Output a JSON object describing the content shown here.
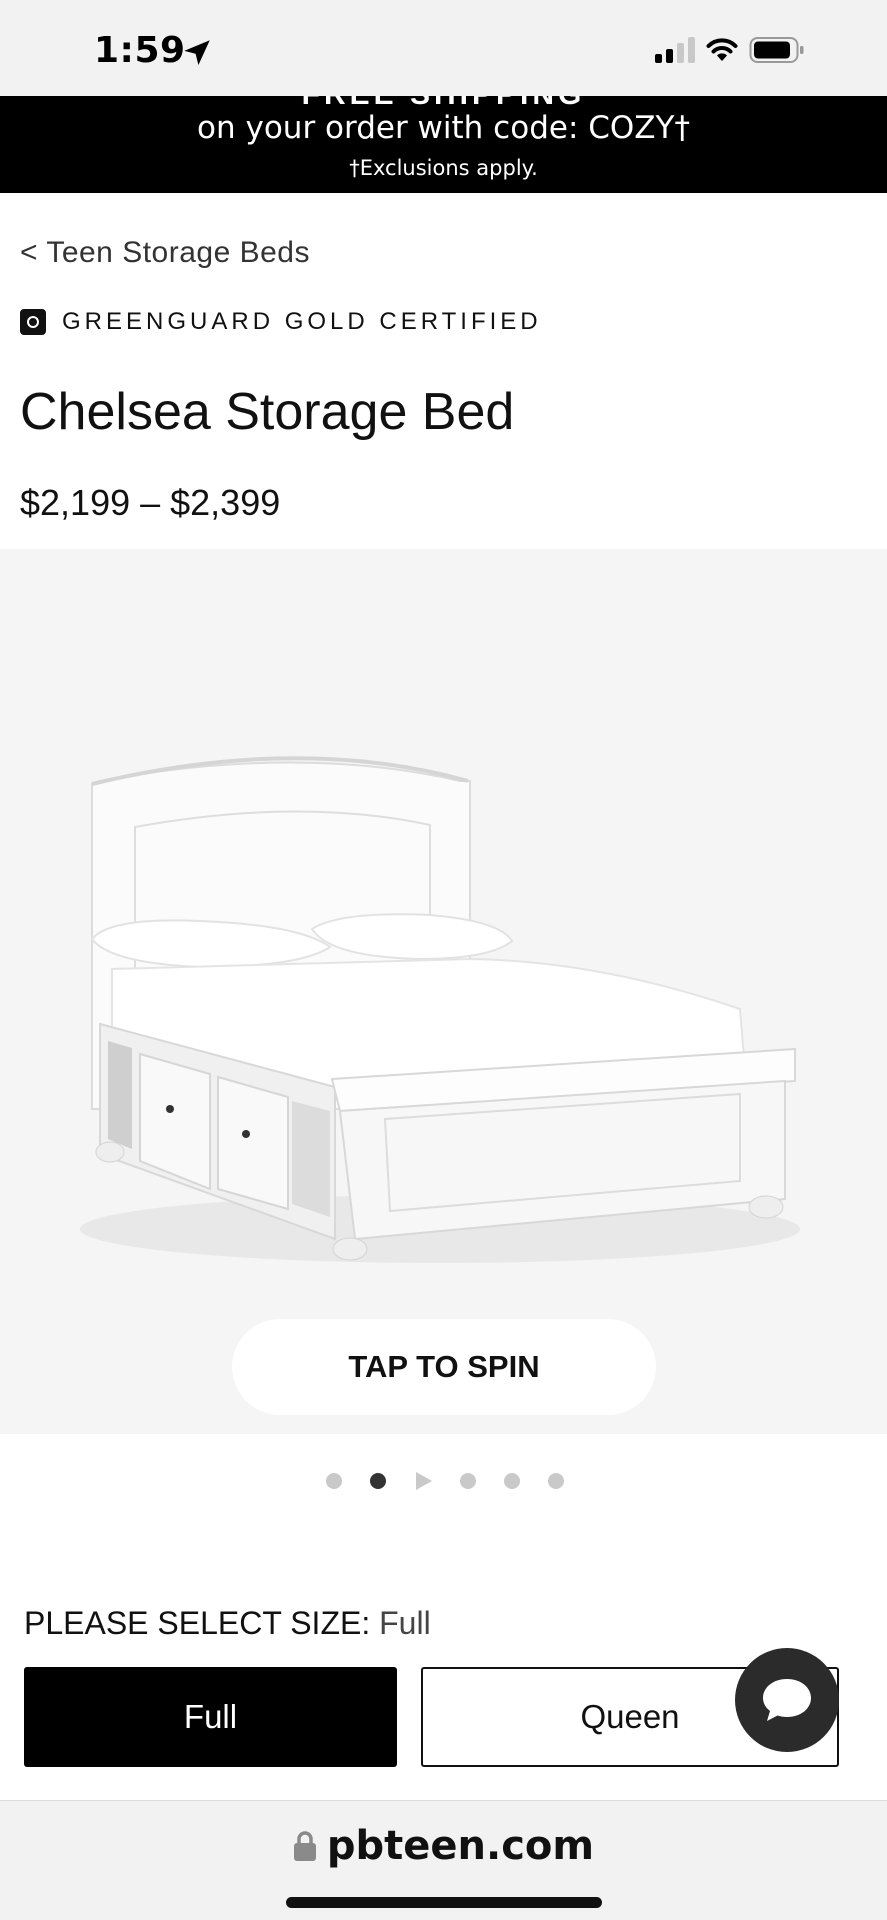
{
  "status_bar": {
    "time": "1:59",
    "icons": [
      "location-arrow-icon",
      "signal-icon",
      "wifi-icon",
      "battery-icon"
    ]
  },
  "promo": {
    "headline": "FREE SHIPPING",
    "line": "on your order with code: COZY†",
    "note": "†Exclusions apply."
  },
  "breadcrumb": {
    "label": "< Teen Storage Beds"
  },
  "certification": {
    "label": "GREENGUARD GOLD CERTIFIED",
    "icon": "greenguard-logo-icon"
  },
  "product": {
    "title": "Chelsea Storage Bed",
    "price": "$2,199 – $2,399"
  },
  "gallery": {
    "spin_label": "TAP TO SPIN",
    "slide_count": 6,
    "active_index": 1
  },
  "size": {
    "label": "PLEASE SELECT SIZE:",
    "selected": "Full",
    "options": [
      "Full",
      "Queen"
    ]
  },
  "browser": {
    "url": "pbteen.com"
  },
  "colors": {
    "promo_bg": "#000000",
    "image_bg": "#f5f5f5",
    "selected_bg": "#000000",
    "chat_bg": "#2b2b2b"
  }
}
